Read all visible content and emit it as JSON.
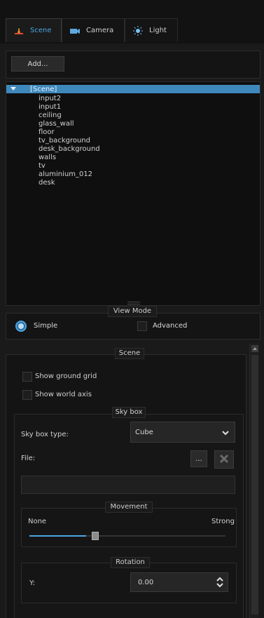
{
  "tabs": [
    {
      "label": "Scene",
      "icon": "scene-icon",
      "active": true
    },
    {
      "label": "Camera",
      "icon": "camera-icon",
      "active": false
    },
    {
      "label": "Light",
      "icon": "light-icon",
      "active": false
    }
  ],
  "toolbar": {
    "add_label": "Add..."
  },
  "tree": {
    "root": "[Scene]",
    "items": [
      "input2",
      "input1",
      "ceiling",
      "glass_wall",
      "floor",
      "tv_background",
      "desk_background",
      "walls",
      "tv",
      "aluminium_012",
      "desk"
    ]
  },
  "view_mode": {
    "title": "View Mode",
    "simple": "Simple",
    "advanced": "Advanced",
    "selected": "Simple"
  },
  "scene_group": {
    "title": "Scene",
    "show_ground_grid": "Show ground grid",
    "show_world_axis": "Show world axis"
  },
  "sky_box": {
    "title": "Sky box",
    "type_label": "Sky box type:",
    "type_value": "Cube",
    "file_label": "File:",
    "browse_label": "...",
    "file_value": ""
  },
  "movement": {
    "title": "Movement",
    "min_label": "None",
    "max_label": "Strong",
    "level": 0.29
  },
  "rotation": {
    "title": "Rotation",
    "y_label": "Y:",
    "y_value": "0.00"
  },
  "colors": {
    "accent": "#4aa6e0",
    "bg": "#1a1a1a"
  }
}
